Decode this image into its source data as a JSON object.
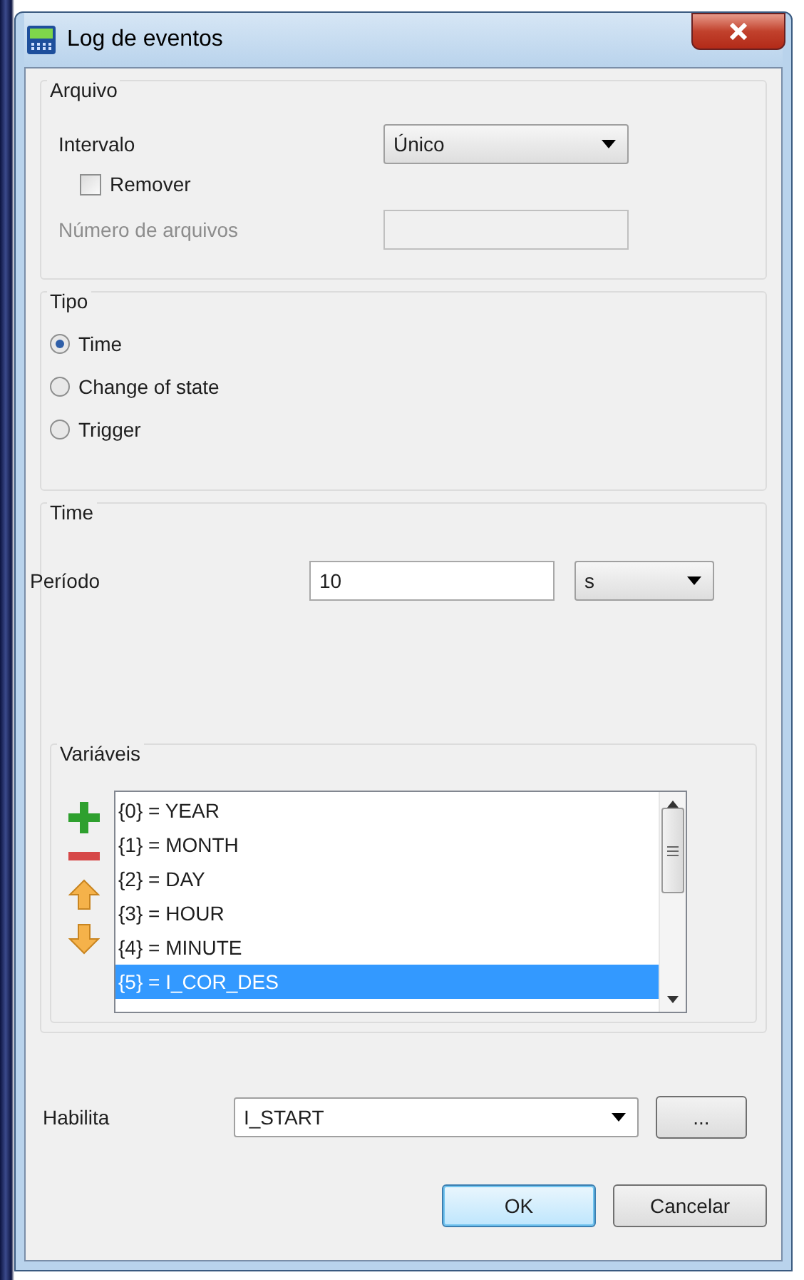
{
  "window": {
    "title": "Log de eventos"
  },
  "arquivo": {
    "legend": "Arquivo",
    "interval_label": "Intervalo",
    "interval_value": "Único",
    "remove": {
      "label": "Remover",
      "checked": false
    },
    "count_label": "Número de arquivos",
    "count_disabled": true
  },
  "tipo": {
    "legend": "Tipo",
    "options": [
      {
        "label": "Time",
        "selected": true
      },
      {
        "label": "Change of state",
        "selected": false
      },
      {
        "label": "Trigger",
        "selected": false
      }
    ]
  },
  "time": {
    "legend": "Time",
    "period_label": "Período",
    "period_value": "10",
    "unit": "s"
  },
  "variaveis": {
    "legend": "Variáveis",
    "items": [
      {
        "label": "{0} = YEAR",
        "selected": false
      },
      {
        "label": "{1} = MONTH",
        "selected": false
      },
      {
        "label": "{2} = DAY",
        "selected": false
      },
      {
        "label": "{3} = HOUR",
        "selected": false
      },
      {
        "label": "{4} = MINUTE",
        "selected": false
      },
      {
        "label": "{5} = I_COR_DES",
        "selected": true
      }
    ]
  },
  "habilita": {
    "label": "Habilita",
    "value": "I_START",
    "browse": "..."
  },
  "buttons": [
    {
      "label": "OK",
      "default": true
    },
    {
      "label": "Cancelar",
      "default": false
    }
  ]
}
